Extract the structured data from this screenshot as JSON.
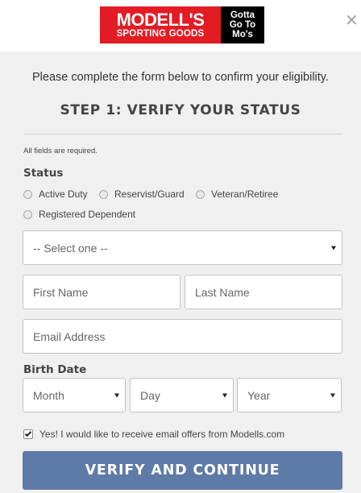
{
  "header": {
    "logo": {
      "line1": "MODELL'S",
      "line2": "SPORTING GOODS",
      "tagline": [
        "Gotta",
        "Go To",
        "Mo's"
      ]
    },
    "close_glyph": "×"
  },
  "intro": "Please complete the form below to confirm your eligibility.",
  "step_title": "STEP 1: VERIFY YOUR STATUS",
  "required_note": "All fields are required.",
  "status": {
    "label": "Status",
    "options": [
      "Active Duty",
      "Reservist/Guard",
      "Veteran/Retiree",
      "Registered Dependent"
    ],
    "select_value": "-- Select one --"
  },
  "fields": {
    "first_name_placeholder": "First Name",
    "last_name_placeholder": "Last Name",
    "email_placeholder": "Email Address"
  },
  "birth_date": {
    "label": "Birth Date",
    "month": "Month",
    "day": "Day",
    "year": "Year"
  },
  "optin": {
    "label": "Yes! I would like to receive email offers from Modells.com",
    "checked": true
  },
  "submit_label": "VERIFY AND CONTINUE",
  "colors": {
    "brand_red": "#e31b23",
    "button": "#5e7aa6",
    "background": "#f0f0f0"
  }
}
